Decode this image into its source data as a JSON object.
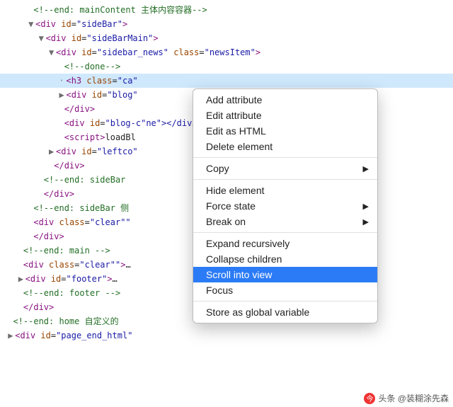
{
  "tree": {
    "r0": {
      "indent": 5,
      "raw": "<!--end: mainContent 主体内容容器-->"
    },
    "r1": {
      "indent": 5,
      "tri": "▼",
      "tag": "div",
      "attrs": [
        [
          "id",
          "sideBar"
        ]
      ]
    },
    "r2": {
      "indent": 7,
      "tri": "▼",
      "tag": "div",
      "attrs": [
        [
          "id",
          "sideBarMain"
        ]
      ]
    },
    "r3": {
      "indent": 9,
      "tri": "▼",
      "tag": "div",
      "attrs": [
        [
          "id",
          "sidebar_news"
        ],
        [
          "class",
          "newsItem"
        ]
      ]
    },
    "r4": {
      "indent": 11,
      "raw": "<!--done-->"
    },
    "r5": {
      "indent": 11,
      "dot": "·",
      "sel": true,
      "tag": "h3",
      "attrs": [
        [
          "class",
          "ca"
        ]
      ],
      "truncated": true
    },
    "r6": {
      "indent": 11,
      "tri": "▶",
      "tag": "div",
      "attrs": [
        [
          "id",
          "blog"
        ]
      ],
      "truncated": true
    },
    "r7": {
      "indent": 11,
      "close": "div"
    },
    "r8": {
      "indent": 11,
      "tag": "div",
      "attrs": [
        [
          "id",
          "blog-c"
        ]
      ],
      "truncatedTail": "ne\"></div…"
    },
    "r9": {
      "indent": 11,
      "script": true,
      "text": "loadBl"
    },
    "r10": {
      "indent": 9,
      "tri": "▶",
      "tag": "div",
      "attrs": [
        [
          "id",
          "leftco"
        ]
      ],
      "truncated": true
    },
    "r11": {
      "indent": 9,
      "close": "div"
    },
    "r12": {
      "indent": 7,
      "raw": "<!--end: sideBar"
    },
    "r13": {
      "indent": 7,
      "close": "div"
    },
    "r14": {
      "indent": 5,
      "raw": "<!--end: sideBar 侧"
    },
    "r15": {
      "indent": 5,
      "tag": "div",
      "attrs": [
        [
          "class",
          "clear\""
        ]
      ],
      "truncated": true
    },
    "r16": {
      "indent": 5,
      "close": "div"
    },
    "r17": {
      "indent": 3,
      "raw": "<!--end: main -->"
    },
    "r18": {
      "indent": 3,
      "tag": "div",
      "attrs": [
        [
          "class",
          "clear\""
        ]
      ],
      "tail": "…"
    },
    "r19": {
      "indent": 3,
      "tri": "▶",
      "tag": "div",
      "attrs": [
        [
          "id",
          "footer"
        ]
      ],
      "tail": "…"
    },
    "r20": {
      "indent": 3,
      "raw": "<!--end: footer -->"
    },
    "r21": {
      "indent": 3,
      "close": "div"
    },
    "r22": {
      "indent": 1,
      "raw": "<!--end: home 自定义的"
    },
    "r23": {
      "indent": 1,
      "tri": "▶",
      "tag": "div",
      "attrs": [
        [
          "id",
          "page_end_html"
        ]
      ],
      "truncated": true
    }
  },
  "menu": {
    "items": [
      {
        "label": "Add attribute"
      },
      {
        "label": "Edit attribute"
      },
      {
        "label": "Edit as HTML"
      },
      {
        "label": "Delete element"
      },
      {
        "sep": true
      },
      {
        "label": "Copy",
        "sub": true
      },
      {
        "sep": true
      },
      {
        "label": "Hide element"
      },
      {
        "label": "Force state",
        "sub": true
      },
      {
        "label": "Break on",
        "sub": true
      },
      {
        "sep": true
      },
      {
        "label": "Expand recursively"
      },
      {
        "label": "Collapse children"
      },
      {
        "label": "Scroll into view",
        "hl": true
      },
      {
        "label": "Focus"
      },
      {
        "sep": true
      },
      {
        "label": "Store as global variable"
      }
    ]
  },
  "watermark": "头条 @装糊涂先森"
}
